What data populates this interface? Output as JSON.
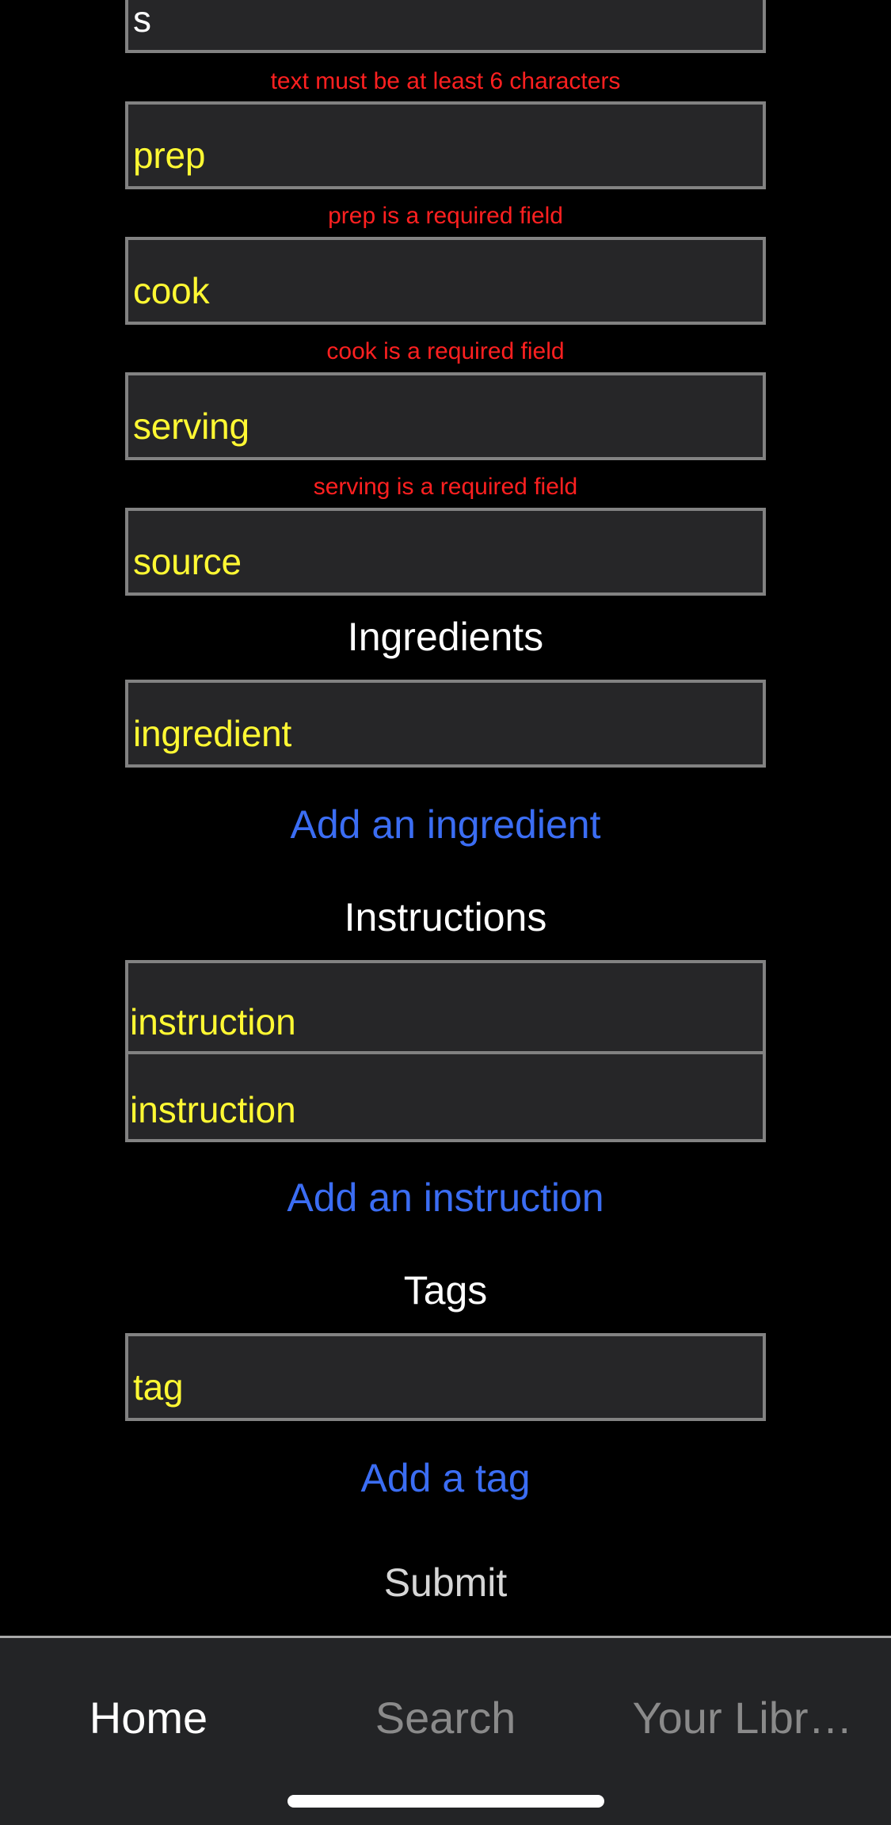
{
  "form": {
    "fields": [
      {
        "name": "summary",
        "value": "s",
        "is_placeholder": false,
        "error": "text must be at least 6 characters"
      },
      {
        "name": "prep",
        "value": "prep",
        "is_placeholder": true,
        "error": "prep is a required field"
      },
      {
        "name": "cook",
        "value": "cook",
        "is_placeholder": true,
        "error": "cook is a required field"
      },
      {
        "name": "serving",
        "value": "serving",
        "is_placeholder": true,
        "error": "serving is a required field"
      },
      {
        "name": "source",
        "value": "source",
        "is_placeholder": true,
        "error": ""
      }
    ],
    "ingredients": {
      "heading": "Ingredients",
      "items": [
        {
          "placeholder": "ingredient"
        }
      ],
      "add_label": "Add an ingredient"
    },
    "instructions": {
      "heading": "Instructions",
      "items": [
        {
          "placeholder": "instruction"
        },
        {
          "placeholder": "instruction"
        }
      ],
      "add_label": "Add an instruction"
    },
    "tags": {
      "heading": "Tags",
      "items": [
        {
          "placeholder": "tag"
        }
      ],
      "add_label": "Add a tag"
    },
    "submit_label": "Submit"
  },
  "tabbar": {
    "tabs": [
      {
        "label": "Home",
        "active": true
      },
      {
        "label": "Search",
        "active": false
      },
      {
        "label": "Your Libr…",
        "active": false
      }
    ]
  },
  "colors": {
    "page_background": "#000000",
    "field_background": "#262628",
    "field_border": "#828282",
    "placeholder_text": "#FFF833",
    "entered_text": "#FFFFFF",
    "error_text": "#FF2020",
    "link_text": "#3B6DF3",
    "heading_text": "#FFFFFF",
    "submit_text": "#D6D6D6",
    "tabbar_background": "#232426",
    "tab_active": "#FFFFFF",
    "tab_inactive": "#8A8A8A",
    "home_indicator": "#FFFFFF"
  }
}
